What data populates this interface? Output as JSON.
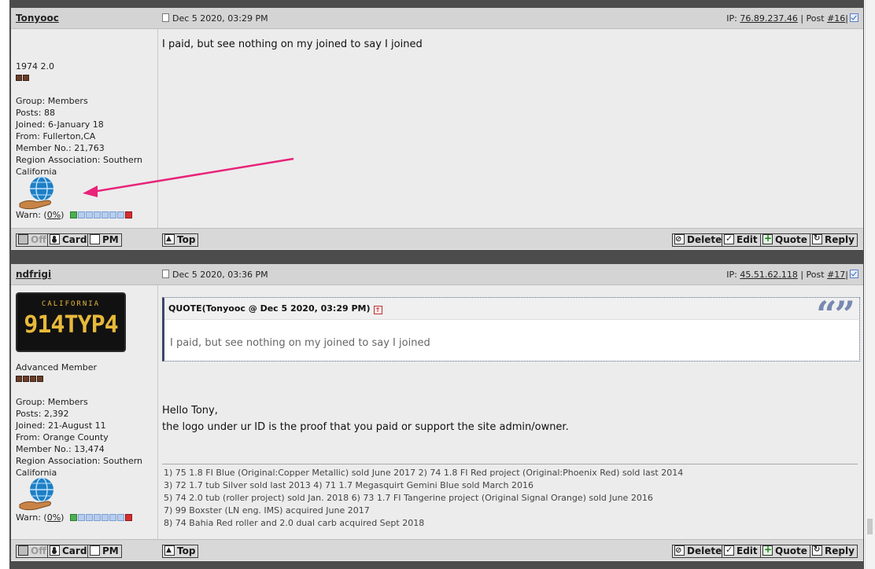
{
  "posts": [
    {
      "author": "Tonyooc",
      "date": "Dec 5 2020, 03:29 PM",
      "ip_label": "IP:",
      "ip": "76.89.237.46",
      "sep": "|",
      "post_label": "Post",
      "post_num": "#16",
      "title": "1974 2.0",
      "rank_pips": 2,
      "group": "Group: Members",
      "posts": "Posts: 88",
      "joined": "Joined: 6-January 18",
      "from": "From: Fullerton,CA",
      "member_no": "Member No.: 21,763",
      "region_1": "Region Association: Southern",
      "region_2": "California",
      "warn_label": "Warn:",
      "warn_open": "(",
      "warn_value": "0%",
      "warn_close": ")",
      "body": "I paid, but see nothing on my joined to say I joined",
      "buttons": {
        "off": "Off",
        "card": "Card",
        "pm": "PM",
        "top": "Top",
        "delete": "Delete",
        "edit": "Edit",
        "quote": "Quote",
        "reply": "Reply"
      }
    },
    {
      "author": "ndfrigi",
      "date": "Dec 5 2020, 03:36 PM",
      "ip_label": "IP:",
      "ip": "45.51.62.118",
      "sep": "|",
      "post_label": "Post",
      "post_num": "#17",
      "plate_state": "CALIFORNIA",
      "plate_number": "914TYP4",
      "title": "Advanced Member",
      "rank_pips": 4,
      "group": "Group: Members",
      "posts": "Posts: 2,392",
      "joined": "Joined: 21-August 11",
      "from": "From: Orange County",
      "member_no": "Member No.: 13,474",
      "region_1": "Region Association: Southern",
      "region_2": "California",
      "warn_label": "Warn:",
      "warn_open": "(",
      "warn_value": "0%",
      "warn_close": ")",
      "quote_title": "QUOTE(Tonyooc @ Dec 5 2020, 03:29 PM)",
      "quote_marks": "“”",
      "quote_text": "I paid, but see nothing on my joined to say I joined",
      "body_1": "Hello Tony,",
      "body_2": "the logo under ur ID is the proof that you paid or support the site admin/owner.",
      "signature": [
        "1) 75 1.8 FI Blue (Original:Copper Metallic) sold June 2017 2) 74 1.8 FI Red project (Original:Phoenix Red) sold last 2014",
        "3) 72 1.7 tub Silver sold last 2013 4) 71 1.7 Megasquirt Gemini Blue sold March 2016",
        "5) 74 2.0 tub (roller project) sold Jan. 2018 6) 73 1.7 FI Tangerine project (Original Signal Orange) sold June 2016",
        "7) 99 Boxster (LN eng. IMS) acquired June 2017",
        "8) 74 Bahia Red roller and 2.0 dual carb acquired Sept 2018"
      ],
      "buttons": {
        "off": "Off",
        "card": "Card",
        "pm": "PM",
        "top": "Top",
        "delete": "Delete",
        "edit": "Edit",
        "quote": "Quote",
        "reply": "Reply"
      }
    }
  ],
  "colors": {
    "arrow": "#e8237a",
    "frame": "#4c4c4c",
    "header": "#d4d4d4",
    "post_bg": "#ececec"
  },
  "icons": [
    "globe-hand-icon",
    "document-icon",
    "checkbox-icon",
    "up-arrow-icon",
    "person-icon",
    "plus-icon",
    "ban-icon",
    "checkmark-icon",
    "reply-icon",
    "quote-back-icon"
  ]
}
